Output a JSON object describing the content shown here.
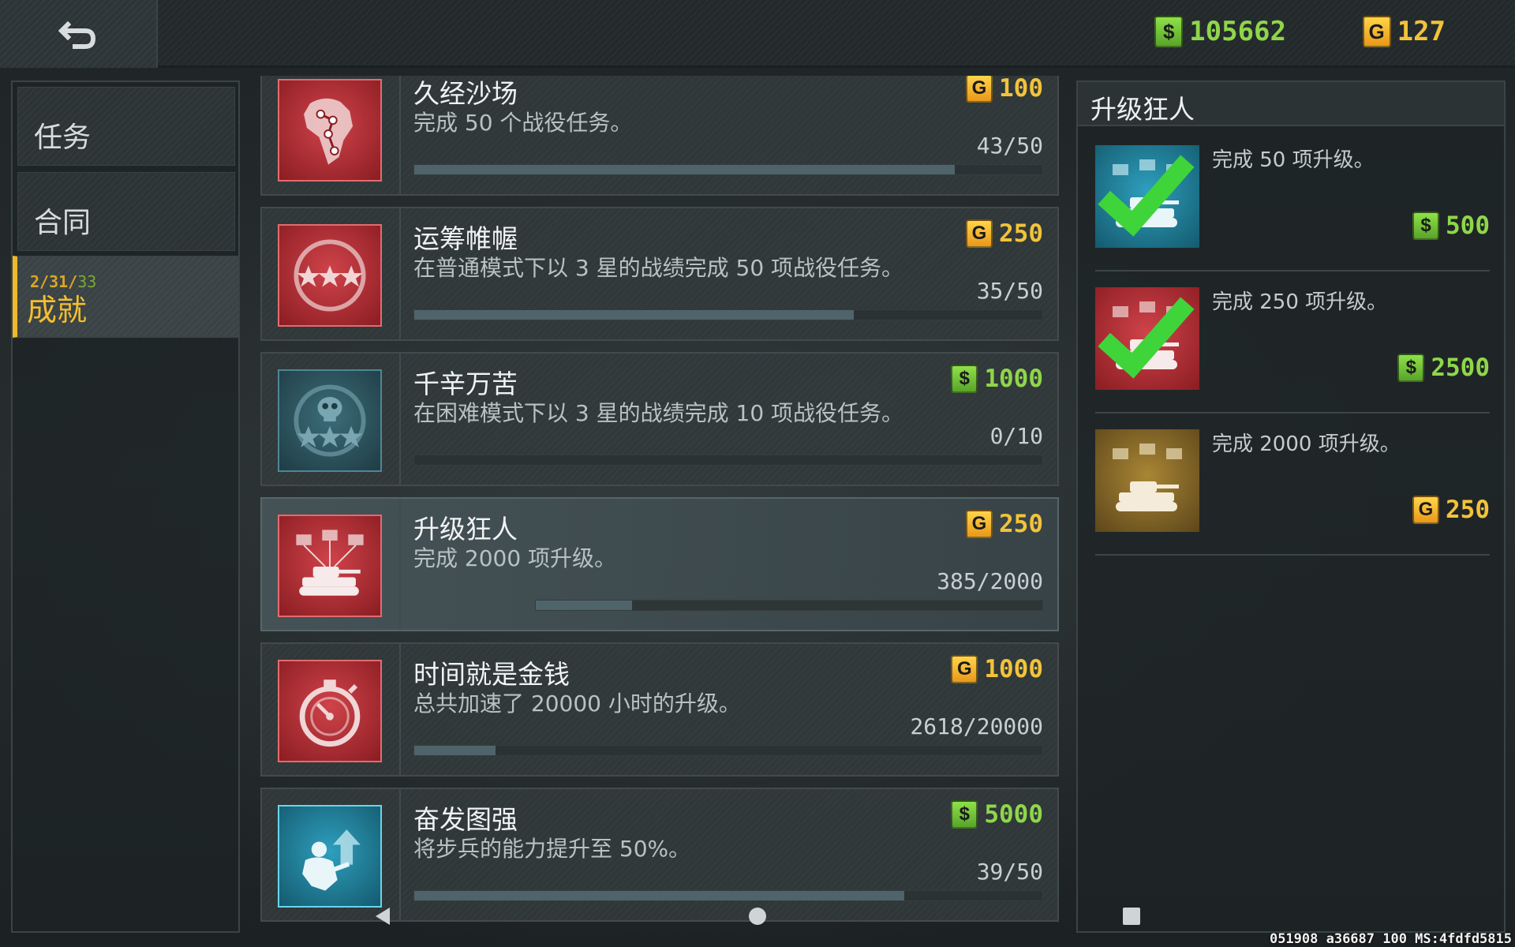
{
  "currency": {
    "cash": "105662",
    "gold": "127",
    "cash_icon": "dollar-icon",
    "gold_icon": "gold-coin-icon"
  },
  "nav": {
    "tabs": [
      {
        "label": "任务"
      },
      {
        "label": "合同"
      },
      {
        "label": "成就",
        "count_a": "2/31/",
        "count_b": "33",
        "active": true
      }
    ]
  },
  "achievements": [
    {
      "title": "久经沙场",
      "desc": "完成 50 个战役任务。",
      "reward": "100",
      "reward_type": "gold",
      "progress": "43/50",
      "fraction": 0.86,
      "icon": "africa-map-icon",
      "color": "red"
    },
    {
      "title": "运筹帷幄",
      "desc": "在普通模式下以 3 星的战绩完成 50 项战役任务。",
      "reward": "250",
      "reward_type": "gold",
      "progress": "35/50",
      "fraction": 0.7,
      "icon": "three-stars-icon",
      "color": "red"
    },
    {
      "title": "千辛万苦",
      "desc": "在困难模式下以 3 星的战绩完成 10 项战役任务。",
      "reward": "1000",
      "reward_type": "cash",
      "progress": "0/10",
      "fraction": 0,
      "icon": "skull-stars-icon",
      "color": "teal"
    },
    {
      "title": "升级狂人",
      "desc": "完成 2000 项升级。",
      "reward": "250",
      "reward_type": "gold",
      "progress": "385/2000",
      "fraction": 0.19,
      "icon": "tank-upgrade-icon",
      "color": "red",
      "selected": true
    },
    {
      "title": "时间就是金钱",
      "desc": "总共加速了 20000 小时的升级。",
      "reward": "1000",
      "reward_type": "gold",
      "progress": "2618/20000",
      "fraction": 0.13,
      "icon": "stopwatch-icon",
      "color": "red"
    },
    {
      "title": "奋发图强",
      "desc": "将步兵的能力提升至 50%。",
      "reward": "5000",
      "reward_type": "cash",
      "progress": "39/50",
      "fraction": 0.78,
      "icon": "soldier-upgrade-icon",
      "color": "blue"
    }
  ],
  "detail": {
    "title": "升级狂人",
    "tiers": [
      {
        "desc": "完成 50 项升级。",
        "reward": "500",
        "reward_type": "cash",
        "completed": true,
        "color": "blue"
      },
      {
        "desc": "完成 250 项升级。",
        "reward": "2500",
        "reward_type": "cash",
        "completed": true,
        "color": "red"
      },
      {
        "desc": "完成 2000 项升级。",
        "reward": "250",
        "reward_type": "gold",
        "completed": false,
        "color": "gold"
      }
    ]
  },
  "footer": "051908 a36687 100 MS:4fdfd5815",
  "colors": {
    "accent": "#f0b92a",
    "cash": "#8fd64a",
    "gold": "#f2c33a"
  }
}
